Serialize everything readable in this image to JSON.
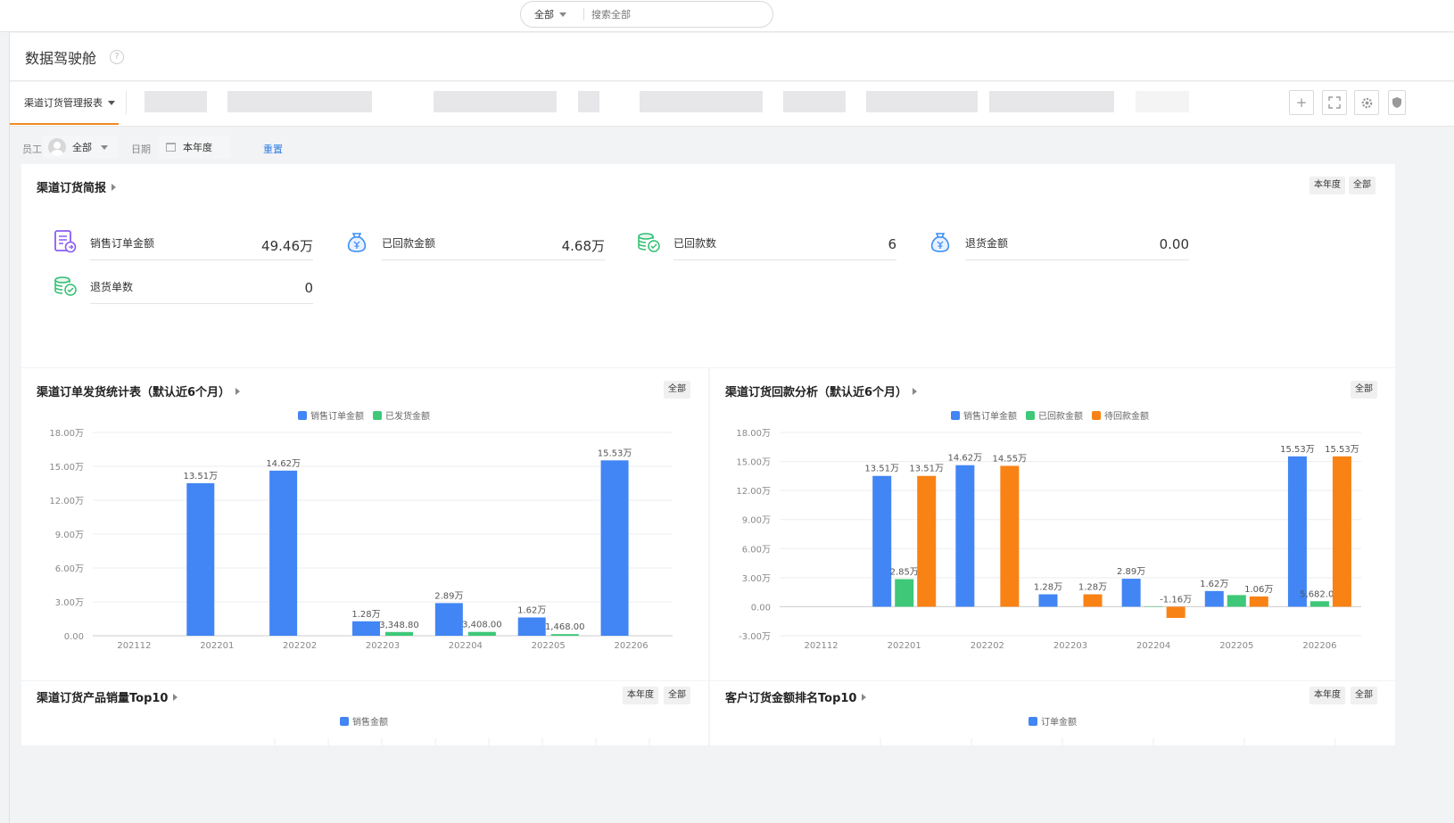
{
  "search": {
    "scope": "全部",
    "placeholder": "搜索全部"
  },
  "page": {
    "title": "数据驾驶舱",
    "help": "?"
  },
  "tabs": {
    "active": "渠道订货管理报表"
  },
  "toolbar": {
    "add": "+",
    "fullscreen": "⛶",
    "settings": "⚙"
  },
  "filters": {
    "employee_label": "员工",
    "employee_value": "全部",
    "date_label": "日期",
    "date_value": "本年度",
    "reset": "重置"
  },
  "brief": {
    "title": "渠道订货简报",
    "chip_year": "本年度",
    "chip_all": "全部",
    "kpis": [
      {
        "label": "销售订单金额",
        "value": "49.46万",
        "icon": "order-doc-icon",
        "color": "#8b5cf6"
      },
      {
        "label": "已回款金额",
        "value": "4.68万",
        "icon": "money-bag-icon",
        "color": "#3b8ff3"
      },
      {
        "label": "已回款数",
        "value": "6",
        "icon": "coin-stack-check-icon",
        "color": "#2fbf71"
      },
      {
        "label": "退货金额",
        "value": "0.00",
        "icon": "money-bag-icon",
        "color": "#3b8ff3"
      },
      {
        "label": "退货单数",
        "value": "0",
        "icon": "coin-stack-check-icon",
        "color": "#2fbf71"
      }
    ]
  },
  "panels": {
    "shipment": {
      "title": "渠道订单发货统计表（默认近6个月）",
      "chip_all": "全部"
    },
    "payment": {
      "title": "渠道订货回款分析（默认近6个月）",
      "chip_all": "全部"
    },
    "product_top": {
      "title": "渠道订货产品销量Top10",
      "chip_year": "本年度",
      "chip_all": "全部",
      "legend": "销售金额"
    },
    "customer_top": {
      "title": "客户订货金额排名Top10",
      "chip_year": "本年度",
      "chip_all": "全部",
      "legend": "订单金额"
    }
  },
  "colors": {
    "blue": "#4285f4",
    "green": "#3ec878",
    "orange": "#f98215"
  },
  "chart_data": [
    {
      "type": "bar",
      "categories": [
        "202112",
        "202201",
        "202202",
        "202203",
        "202204",
        "202205",
        "202206"
      ],
      "series": [
        {
          "name": "销售订单金额",
          "values": [
            0,
            13.51,
            14.62,
            1.28,
            2.89,
            1.62,
            15.53
          ],
          "labels": [
            "",
            "13.51万",
            "14.62万",
            "1.28万",
            "2.89万",
            "1.62万",
            "15.53万"
          ]
        },
        {
          "name": "已发货金额",
          "values": [
            0,
            0,
            0,
            0.33488,
            0.3408,
            0.1468,
            0
          ],
          "labels": [
            "",
            "",
            "",
            "3,348.80",
            "3,408.00",
            "1,468.00",
            ""
          ]
        }
      ],
      "yticks": [
        "0.00",
        "3.00万",
        "6.00万",
        "9.00万",
        "12.00万",
        "15.00万",
        "18.00万"
      ],
      "ylim": [
        0,
        18
      ]
    },
    {
      "type": "bar",
      "categories": [
        "202112",
        "202201",
        "202202",
        "202203",
        "202204",
        "202205",
        "202206"
      ],
      "series": [
        {
          "name": "销售订单金额",
          "values": [
            0,
            13.51,
            14.62,
            1.28,
            2.89,
            1.62,
            15.53
          ],
          "labels": [
            "",
            "13.51万",
            "14.62万",
            "1.28万",
            "2.89万",
            "1.62万",
            "15.53万"
          ]
        },
        {
          "name": "已回款金额",
          "values": [
            0,
            2.85,
            0,
            0,
            0.05,
            1.2,
            0.568
          ],
          "labels": [
            "",
            "2.85万",
            "",
            "",
            "",
            "",
            "5,682.00"
          ]
        },
        {
          "name": "待回款金额",
          "values": [
            0,
            13.51,
            14.55,
            1.28,
            -1.16,
            1.06,
            15.53
          ],
          "labels": [
            "",
            "13.51万",
            "14.55万",
            "1.28万",
            "-1.16万",
            "1.06万",
            "15.53万"
          ]
        }
      ],
      "yticks": [
        "-3.00万",
        "0.00",
        "3.00万",
        "6.00万",
        "9.00万",
        "12.00万",
        "15.00万",
        "18.00万"
      ],
      "ylim": [
        -3,
        18
      ]
    }
  ]
}
